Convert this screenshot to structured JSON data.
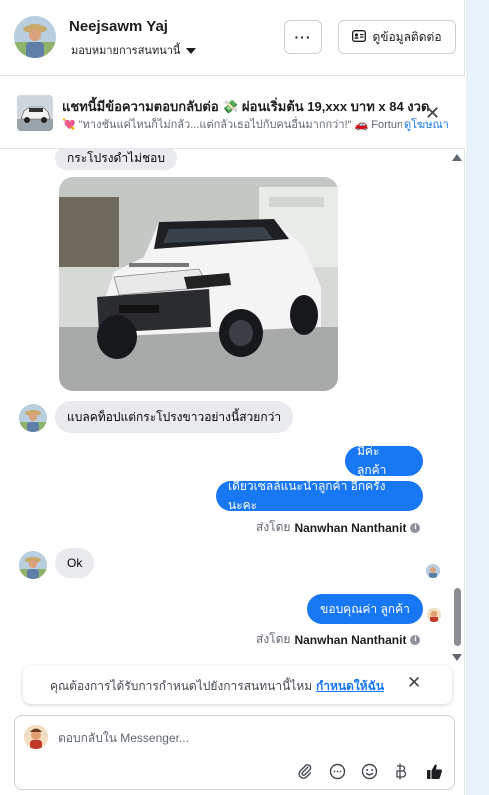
{
  "header": {
    "name": "Neejsawm Yaj",
    "assign_label": "มอบหมายการสนทนานี้",
    "more_label": "···",
    "contact_button": "ดูข้อมูลติดต่อ"
  },
  "ad": {
    "title": "แชทนี้มีข้อความตอบกลับต่อ 💸 ผ่อนเริ่มต้น 19,xxx บาท x 84 งวด",
    "description": "💘 \"ทางชันแค่ไหนก็ไม่กลัว...แต่กลัวเธอไปกับคนอื่นมากกว่า!\" 🚗 Fortun...",
    "link": "ดูโฆษณา",
    "close": "✕"
  },
  "messages": {
    "m1": "กระโปรงดำไม่ชอบ",
    "m2": "แบลคท็อปแต่กระโปรงขาวอย่างนี้สวยกว่า",
    "m3": "มีค่ะ ลูกค้า",
    "m4": "เดี๋ยวเซลล์แนะนำลูกค้า อีกครั้ง นะคะ",
    "m5": "Ok",
    "m6": "ขอบคุณค่า ลูกค้า"
  },
  "sent_by": {
    "prefix": "ส่งโดย",
    "name": "Nanwhan Nanthanit"
  },
  "assign_prompt": {
    "text": "คุณต้องการได้รับการกำหนดไปยังการสนทนานี้ไหม",
    "link": "กำหนดให้ฉัน",
    "close": "✕"
  },
  "composer": {
    "placeholder": "ตอบกลับใน Messenger...",
    "value": ""
  },
  "colors": {
    "accent": "#1877f2",
    "incoming_bubble": "#e9eaed",
    "right_strip": "#e9f1fb"
  },
  "icons": [
    "dots-icon",
    "contact-card-icon",
    "chevron-down-icon",
    "close-icon",
    "attachment-icon",
    "chat-icon",
    "emoji-icon",
    "baht-icon",
    "thumbs-up-icon"
  ]
}
